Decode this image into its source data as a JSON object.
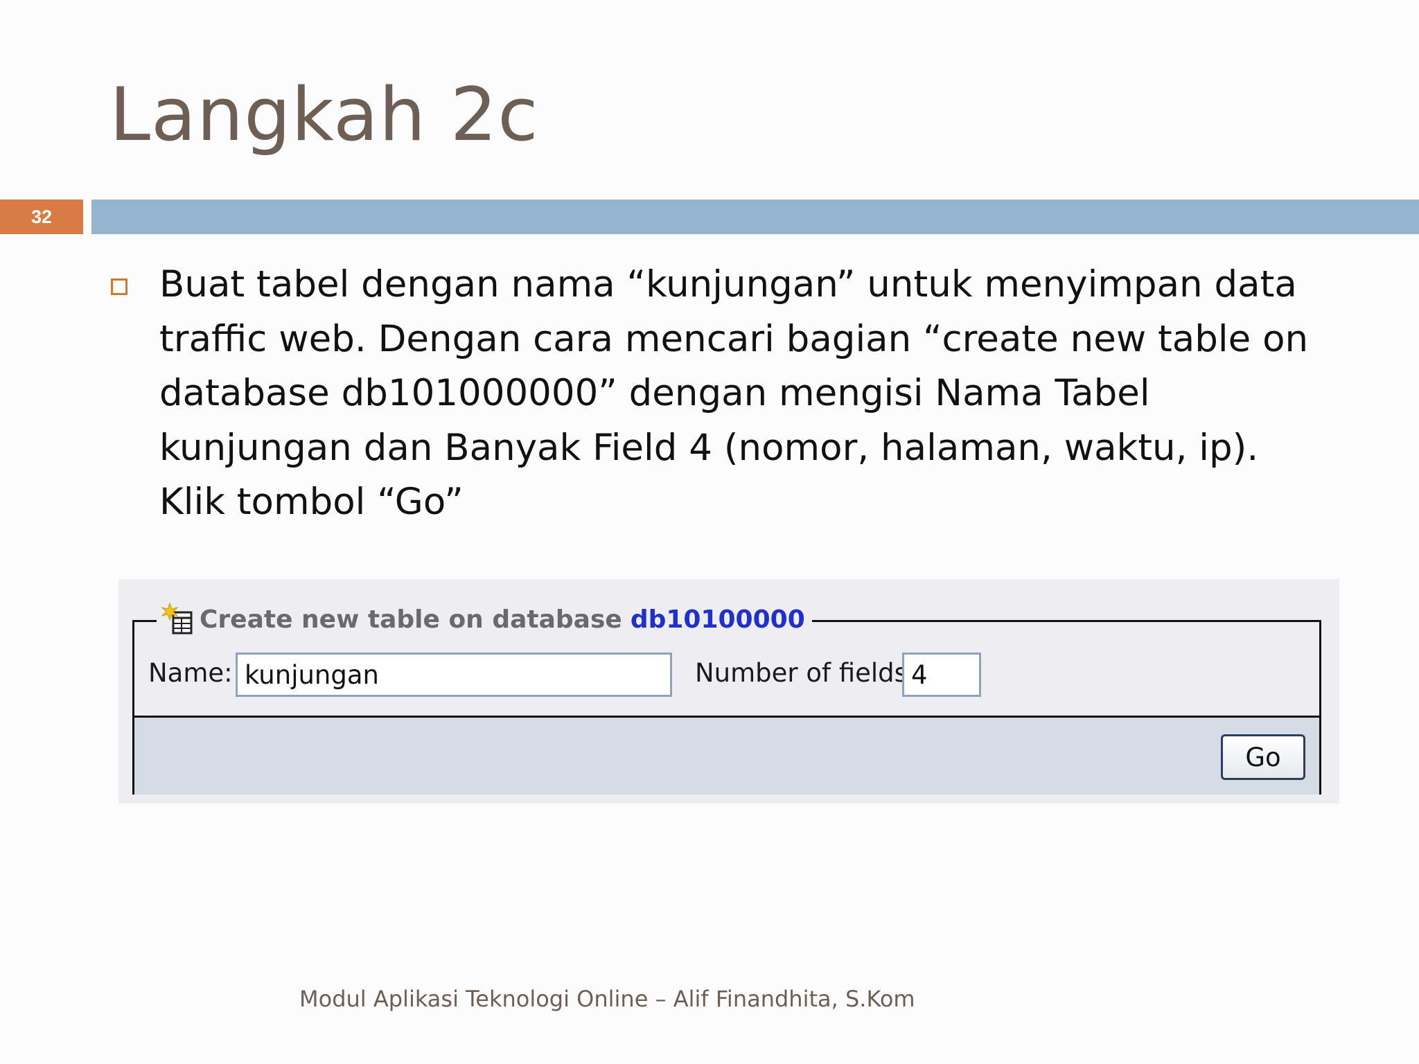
{
  "slide": {
    "title": "Langkah 2c",
    "number": "32",
    "bullet_text": "Buat tabel dengan nama “kunjungan” untuk menyimpan data traffic web. Dengan cara mencari bagian “create new table on database db101000000” dengan mengisi Nama Tabel kunjungan dan Banyak Field 4 (nomor, halaman, waktu, ip). Klik tombol “Go”",
    "footer": "Modul Aplikasi Teknologi Online – Alif Finandhita, S.Kom"
  },
  "create_table_form": {
    "legend_label": "Create new table on database",
    "database_name": "db10100000",
    "legend_icon": "new-table-icon",
    "name_label": "Name:",
    "name_value": "kunjungan",
    "fields_label": "Number of fields:",
    "fields_value": "4",
    "go_label": "Go"
  },
  "colors": {
    "title": "#6e5f55",
    "slide_number_bg": "#d87b44",
    "title_bar": "#95b4d0",
    "bullet": "#d0782f",
    "database_link": "#1f2fd0",
    "form_footer_bg": "#d6dce5"
  }
}
